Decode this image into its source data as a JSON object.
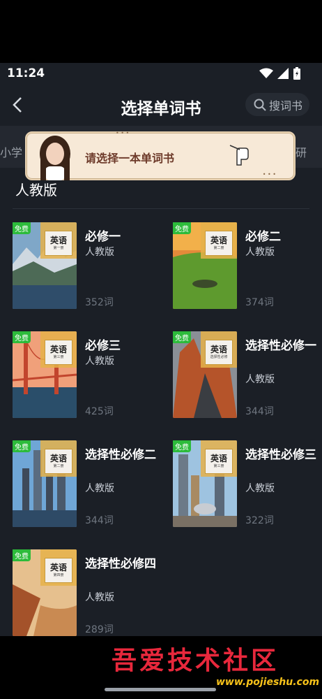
{
  "status": {
    "time": "11:24"
  },
  "header": {
    "title": "选择单词书",
    "search_label": "搜词书"
  },
  "tabs": {
    "left": "小学",
    "right": "研"
  },
  "banner": {
    "message": "请选择一本单词书"
  },
  "section": {
    "title": "人教版"
  },
  "badge": "免费",
  "cover_logo": "英语",
  "books": [
    {
      "name": "必修一",
      "version": "人教版",
      "count": "352词",
      "cover_sub": "第一册"
    },
    {
      "name": "必修二",
      "version": "人教版",
      "count": "374词",
      "cover_sub": "第二册"
    },
    {
      "name": "必修三",
      "version": "人教版",
      "count": "425词",
      "cover_sub": "第三册"
    },
    {
      "name": "选择性必修一",
      "version": "人教版",
      "count": "344词",
      "cover_sub": "选择性必修"
    },
    {
      "name": "选择性必修二",
      "version": "人教版",
      "count": "344词",
      "cover_sub": "第二册"
    },
    {
      "name": "选择性必修三",
      "version": "人教版",
      "count": "322词",
      "cover_sub": "第三册"
    },
    {
      "name": "选择性必修四",
      "version": "人教版",
      "count": "289词",
      "cover_sub": "第四册"
    }
  ],
  "watermark": {
    "text": "吾爱技术社区",
    "url": "www.pojieshu.com"
  },
  "colors": {
    "background": "#1b1f26",
    "free_badge": "#2dbb3b",
    "banner": "#f7e9d7"
  }
}
